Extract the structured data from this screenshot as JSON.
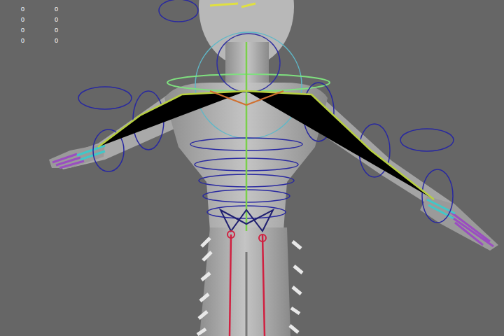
{
  "viewport": {
    "hud": [
      [
        "0",
        "0"
      ],
      [
        "0",
        "0"
      ],
      [
        "0",
        "0"
      ],
      [
        "0",
        "0"
      ]
    ]
  }
}
